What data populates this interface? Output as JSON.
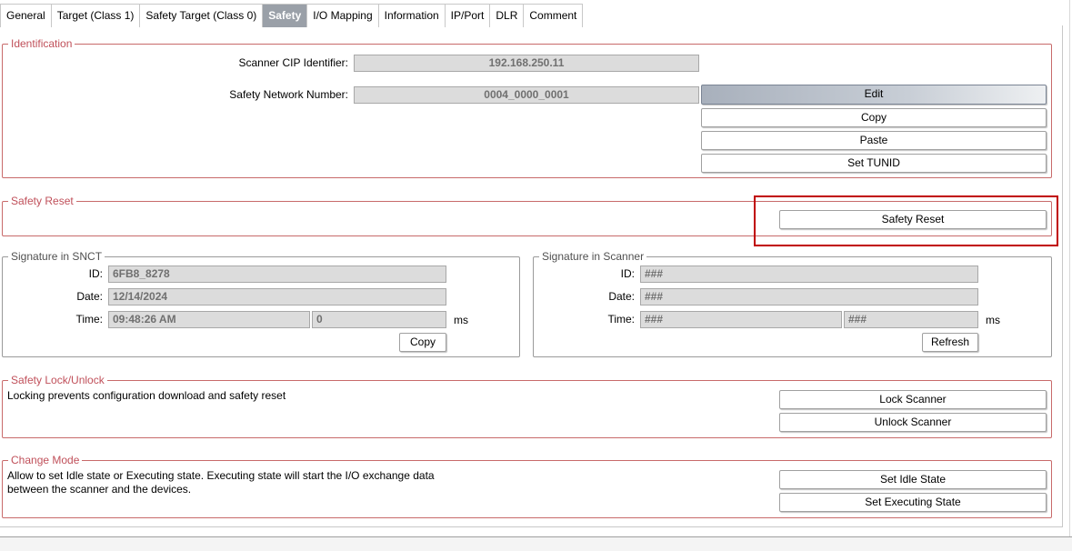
{
  "tabs": [
    {
      "label": "General"
    },
    {
      "label": "Target (Class 1)"
    },
    {
      "label": "Safety Target (Class 0)"
    },
    {
      "label": "Safety",
      "active": true
    },
    {
      "label": "I/O Mapping"
    },
    {
      "label": "Information"
    },
    {
      "label": "IP/Port"
    },
    {
      "label": "DLR"
    },
    {
      "label": "Comment"
    }
  ],
  "identification": {
    "title": "Identification",
    "scanner_cip_label": "Scanner CIP Identifier:",
    "scanner_cip_value": "192.168.250.11",
    "snn_label": "Safety Network Number:",
    "snn_value": "0004_0000_0001",
    "edit_label": "Edit",
    "copy_label": "Copy",
    "paste_label": "Paste",
    "set_tunid_label": "Set TUNID"
  },
  "safety_reset": {
    "title": "Safety Reset",
    "button_label": "Safety Reset"
  },
  "signature_snct": {
    "title": "Signature in SNCT",
    "id_label": "ID:",
    "id_value": "6FB8_8278",
    "date_label": "Date:",
    "date_value": "12/14/2024",
    "time_label": "Time:",
    "time_value": "09:48:26 AM",
    "ms_value": "0",
    "ms_label": "ms",
    "copy_label": "Copy"
  },
  "signature_scanner": {
    "title": "Signature in Scanner",
    "id_label": "ID:",
    "id_value": "###",
    "date_label": "Date:",
    "date_value": "###",
    "time_label": "Time:",
    "time_value": "###",
    "ms_value": "###",
    "ms_label": "ms",
    "refresh_label": "Refresh"
  },
  "lock_unlock": {
    "title": "Safety Lock/Unlock",
    "description": "Locking prevents configuration download and safety reset",
    "lock_label": "Lock Scanner",
    "unlock_label": "Unlock Scanner"
  },
  "change_mode": {
    "title": "Change Mode",
    "description_line1": "Allow to set Idle state or Executing state. Executing state will start the I/O exchange data",
    "description_line2": "between the scanner and the devices.",
    "idle_label": "Set Idle State",
    "executing_label": "Set Executing State"
  },
  "colors": {
    "group_border": "#c86a6a",
    "legend_text": "#c0505a",
    "highlight": "#c00000",
    "active_tab": "#9aa0a8"
  }
}
